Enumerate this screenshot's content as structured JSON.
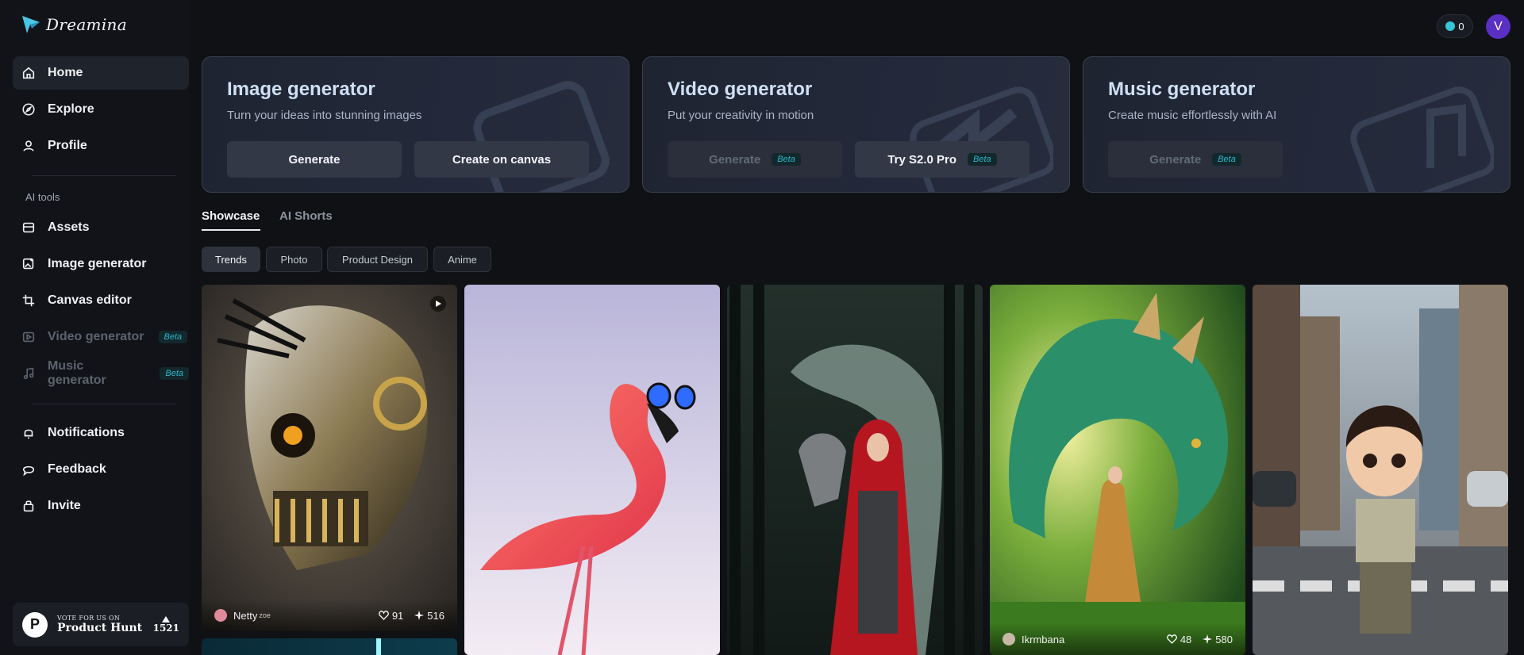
{
  "app": {
    "logo_text": "Dreamina"
  },
  "sidebar": {
    "items": [
      {
        "label": "Home",
        "icon": "home-icon"
      },
      {
        "label": "Explore",
        "icon": "compass-icon"
      },
      {
        "label": "Profile",
        "icon": "user-icon"
      }
    ],
    "tools_label": "AI tools",
    "tools": [
      {
        "label": "Assets",
        "icon": "folder-icon"
      },
      {
        "label": "Image generator",
        "icon": "image-plus-icon"
      },
      {
        "label": "Canvas editor",
        "icon": "crop-icon"
      },
      {
        "label": "Video generator",
        "icon": "video-icon",
        "beta": "Beta"
      },
      {
        "label": "Music generator",
        "icon": "music-icon",
        "beta": "Beta"
      }
    ],
    "bottom": [
      {
        "label": "Notifications",
        "icon": "bell-icon"
      },
      {
        "label": "Feedback",
        "icon": "chat-icon"
      },
      {
        "label": "Invite",
        "icon": "gift-icon"
      }
    ],
    "product_hunt": {
      "small": "VOTE FOR US ON",
      "big": "Product Hunt",
      "count": "1521",
      "logo_letter": "P"
    }
  },
  "topbar": {
    "credits": "0",
    "avatar_letter": "V"
  },
  "generators": [
    {
      "title": "Image generator",
      "subtitle": "Turn your ideas into stunning images",
      "buttons": [
        {
          "label": "Generate"
        },
        {
          "label": "Create on canvas"
        }
      ]
    },
    {
      "title": "Video generator",
      "subtitle": "Put your creativity in motion",
      "buttons": [
        {
          "label": "Generate",
          "beta": "Beta"
        },
        {
          "label": "Try S2.0 Pro",
          "beta": "Beta"
        }
      ]
    },
    {
      "title": "Music generator",
      "subtitle": "Create music effortlessly with AI",
      "buttons": [
        {
          "label": "Generate",
          "beta": "Beta"
        }
      ]
    }
  ],
  "tabs": [
    "Showcase",
    "AI Shorts"
  ],
  "filters": [
    "Trends",
    "Photo",
    "Product Design",
    "Anime"
  ],
  "gallery": [
    {
      "author": "Netty",
      "author_suffix": "zoe",
      "likes": "91",
      "uses": "516"
    },
    {
      "author": "",
      "likes": "",
      "uses": ""
    },
    {
      "author": "",
      "likes": "",
      "uses": ""
    },
    {
      "author": "Ikrmbana",
      "likes": "48",
      "uses": "580"
    },
    {
      "author": "",
      "likes": "",
      "uses": ""
    }
  ],
  "colors": {
    "background": "#0f1115",
    "accent": "#2bb7c9",
    "avatar": "#5a2fc4"
  }
}
